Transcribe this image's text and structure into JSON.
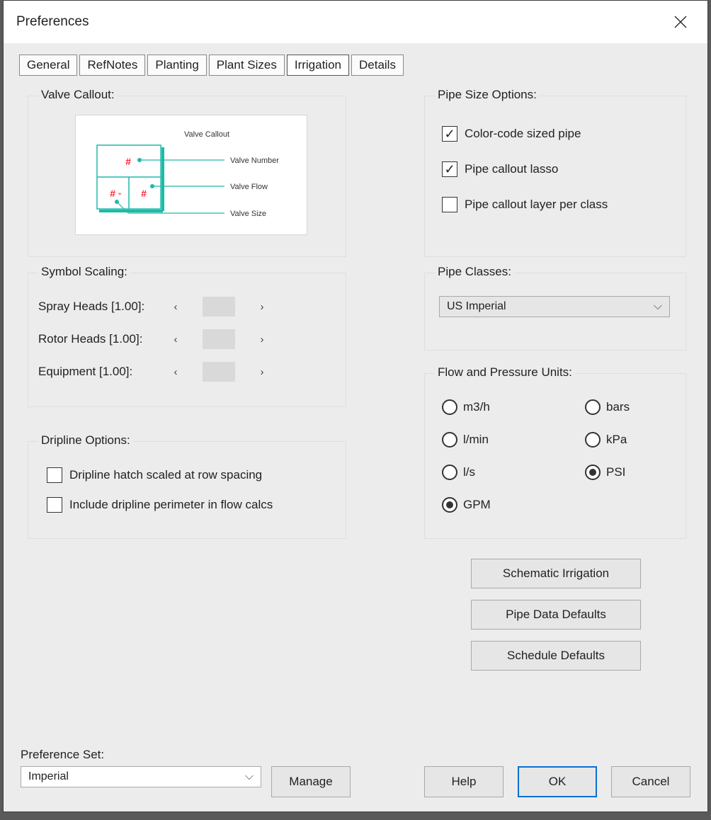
{
  "window": {
    "title": "Preferences"
  },
  "tabs": [
    "General",
    "RefNotes",
    "Planting",
    "Plant Sizes",
    "Irrigation",
    "Details"
  ],
  "active_tab": "Irrigation",
  "valve_callout": {
    "title": "Valve Callout:",
    "diagram_title": "Valve Callout",
    "labels": [
      "Valve Number",
      "Valve Flow",
      "Valve Size"
    ]
  },
  "symbol_scaling": {
    "title": "Symbol Scaling:",
    "rows": [
      {
        "label": "Spray Heads [1.00]:"
      },
      {
        "label": "Rotor Heads [1.00]:"
      },
      {
        "label": "Equipment [1.00]:"
      }
    ]
  },
  "dripline": {
    "title": "Dripline Options:",
    "options": [
      {
        "label": "Dripline hatch scaled at row spacing",
        "checked": false
      },
      {
        "label": "Include dripline perimeter in flow calcs",
        "checked": false
      }
    ]
  },
  "pipe_size": {
    "title": "Pipe Size Options:",
    "options": [
      {
        "label": "Color-code sized pipe",
        "checked": true
      },
      {
        "label": "Pipe callout lasso",
        "checked": true
      },
      {
        "label": "Pipe callout layer per class",
        "checked": false
      }
    ]
  },
  "pipe_classes": {
    "title": "Pipe Classes:",
    "value": "US Imperial"
  },
  "flow_pressure": {
    "title": "Flow and Pressure Units:",
    "left": [
      {
        "label": "m3/h",
        "checked": false
      },
      {
        "label": "l/min",
        "checked": false
      },
      {
        "label": "l/s",
        "checked": false
      },
      {
        "label": "GPM",
        "checked": true
      }
    ],
    "right": [
      {
        "label": "bars",
        "checked": false
      },
      {
        "label": "kPa",
        "checked": false
      },
      {
        "label": "PSI",
        "checked": true
      }
    ]
  },
  "side_buttons": [
    "Schematic Irrigation",
    "Pipe Data Defaults",
    "Schedule Defaults"
  ],
  "pref_set": {
    "label": "Preference Set:",
    "value": "Imperial",
    "manage": "Manage"
  },
  "footer": {
    "help": "Help",
    "ok": "OK",
    "cancel": "Cancel"
  }
}
